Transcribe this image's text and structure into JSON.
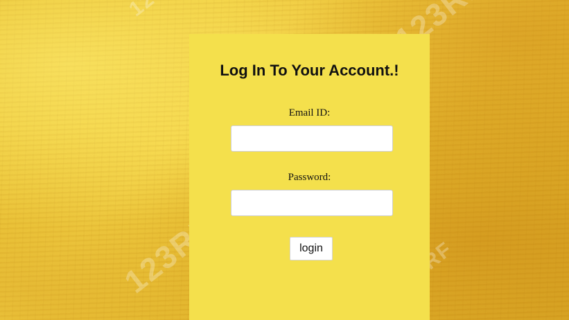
{
  "login": {
    "title": "Log In To Your Account.!",
    "email_label": "Email ID:",
    "email_value": "",
    "password_label": "Password:",
    "password_value": "",
    "submit_label": "login"
  },
  "watermark": {
    "text": "123RF"
  },
  "colors": {
    "card_background": "#f4e04c",
    "page_background": "#e9c130",
    "input_background": "#ffffff",
    "text": "#111111"
  }
}
